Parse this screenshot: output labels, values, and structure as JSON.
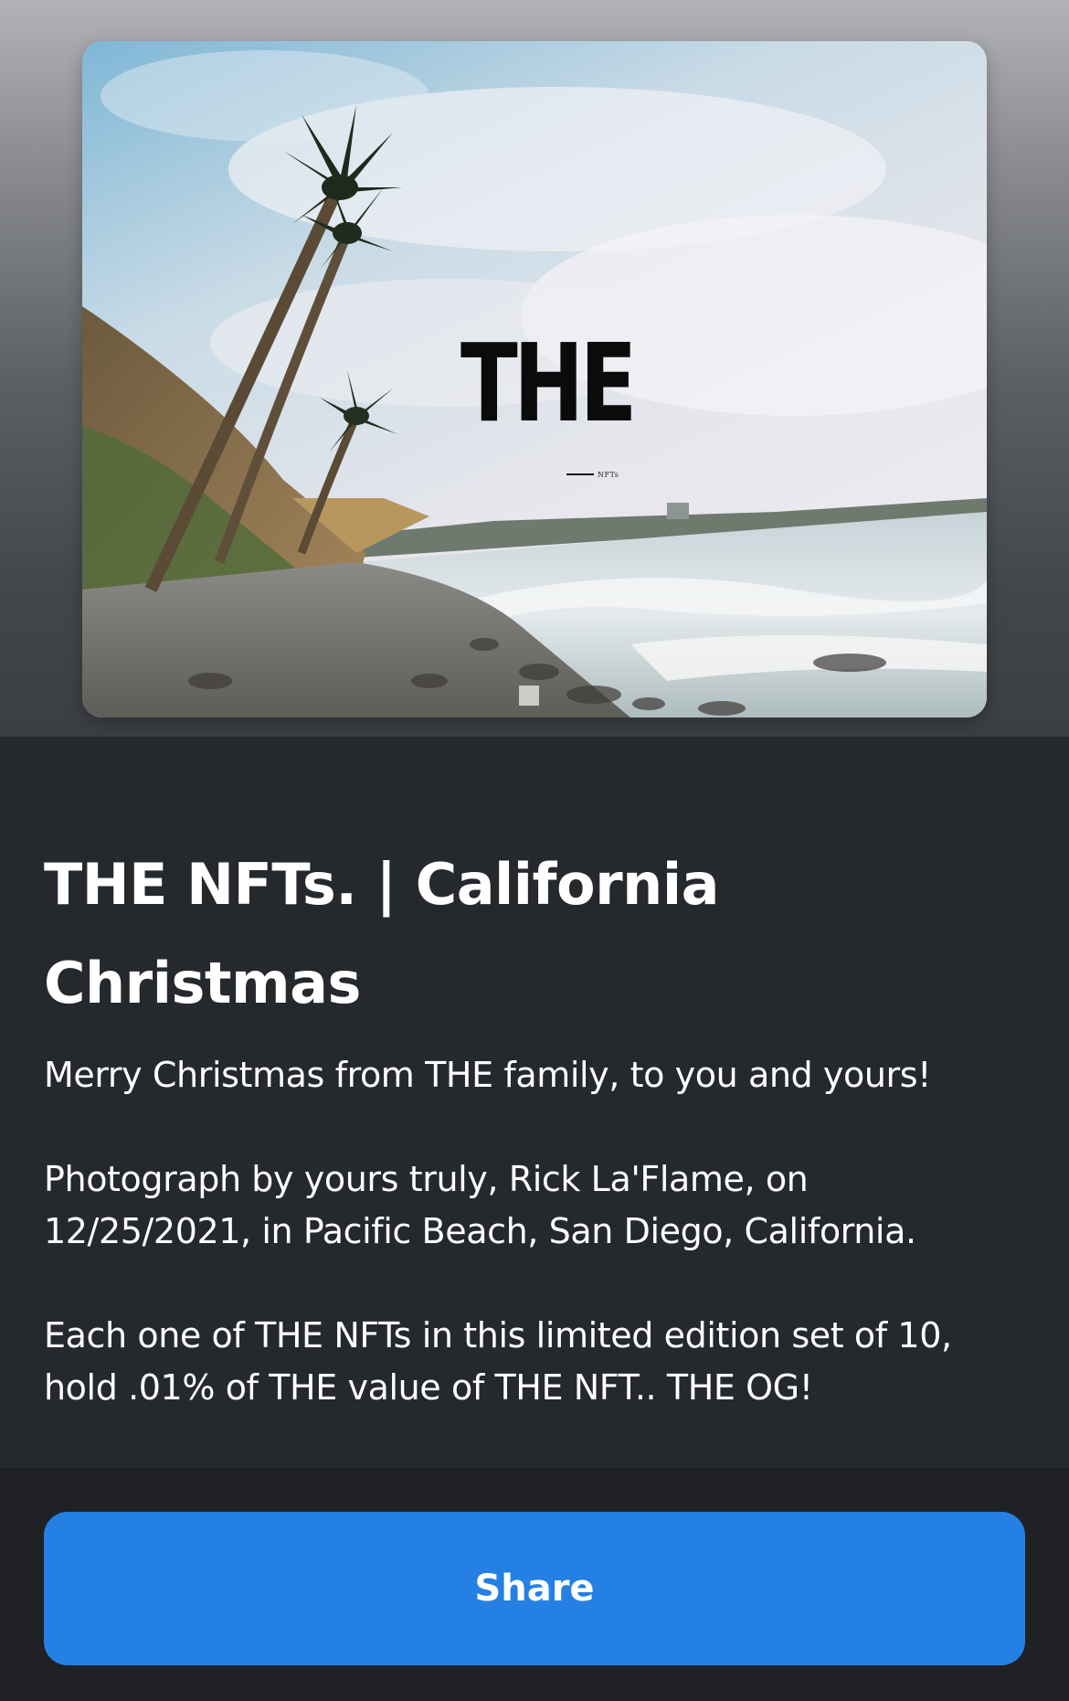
{
  "nft_image": {
    "logo_text": "THE",
    "logo_subtext": "NFTs"
  },
  "title_line1": "THE NFTs. | California",
  "title_line2": "Christmas",
  "description": {
    "p1": "Merry Christmas from THE family, to you and yours!",
    "p2_line1": "Photograph by yours truly, Rick La'Flame, on",
    "p2_line2": "12/25/2021, in Pacific Beach, San Diego, California.",
    "p3_line1": "Each one of THE NFTs in this limited edition set of 10,",
    "p3_line2": "hold .01% of THE value of THE NFT.. THE OG!"
  },
  "share_label": "Share",
  "colors": {
    "background": "#25282d",
    "footer": "#1f2125",
    "accent": "#2580e3",
    "text": "#ffffff"
  }
}
